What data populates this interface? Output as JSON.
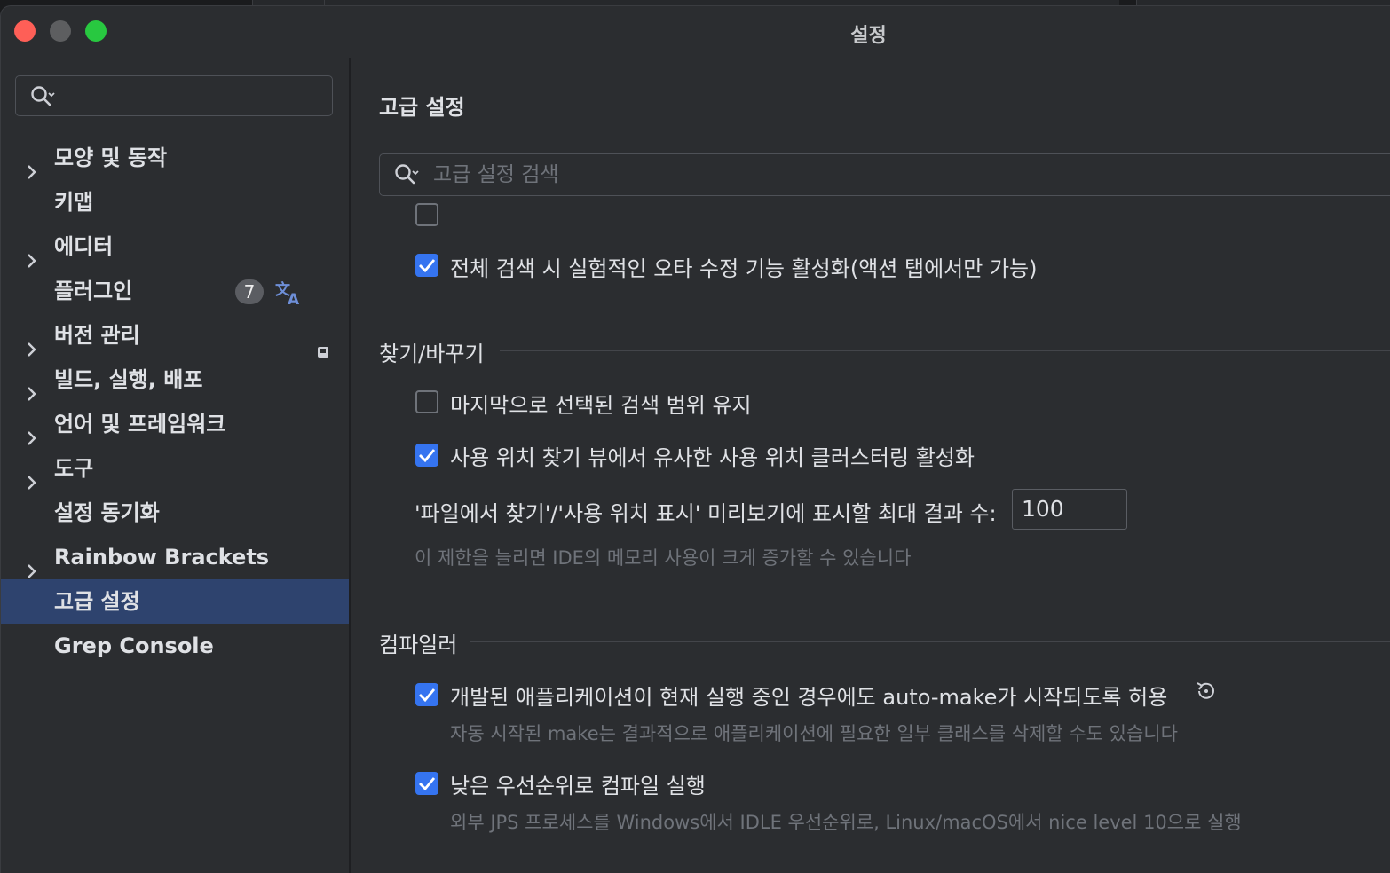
{
  "window": {
    "title": "설정"
  },
  "sidebar": {
    "search": {
      "placeholder": ""
    },
    "items": [
      {
        "label": "모양 및 동작",
        "expandable": true
      },
      {
        "label": "키맵",
        "expandable": false
      },
      {
        "label": "에디터",
        "expandable": true
      },
      {
        "label": "플러그인",
        "expandable": false,
        "badge": "7",
        "icon": "translate-icon"
      },
      {
        "label": "버전 관리",
        "expandable": true,
        "icon": "vcs-project-icon"
      },
      {
        "label": "빌드, 실행, 배포",
        "expandable": true
      },
      {
        "label": "언어 및 프레임워크",
        "expandable": true
      },
      {
        "label": "도구",
        "expandable": true
      },
      {
        "label": "설정 동기화",
        "expandable": false
      },
      {
        "label": "Rainbow Brackets",
        "expandable": true
      },
      {
        "label": "고급 설정",
        "expandable": false,
        "selected": true
      },
      {
        "label": "Grep Console",
        "expandable": false
      }
    ]
  },
  "main": {
    "title": "고급 설정",
    "search": {
      "placeholder": "고급 설정 검색"
    },
    "top_options": [
      {
        "label": "전체 검색 시 실험적인 오타 수정 기능 활성화(액션 탭에서만 가능)",
        "checked": true
      }
    ],
    "sections": [
      {
        "title": "찾기/바꾸기",
        "options": [
          {
            "label": "마지막으로 선택된 검색 범위 유지",
            "checked": false
          },
          {
            "label": "사용 위치 찾기 뷰에서 유사한 사용 위치 클러스터링 활성화",
            "checked": true
          }
        ],
        "field": {
          "label": "'파일에서 찾기'/'사용 위치 표시' 미리보기에 표시할 최대 결과 수:",
          "value": "100",
          "hint": "이 제한을 늘리면 IDE의 메모리 사용이 크게 증가할 수 있습니다"
        }
      },
      {
        "title": "컴파일러",
        "options": [
          {
            "label": "개발된 애플리케이션이 현재 실행 중인 경우에도 auto-make가 시작되도록 허용",
            "checked": true,
            "hint": "자동 시작된 make는 결과적으로 애플리케이션에 필요한 일부 클래스를 삭제할 수도 있습니다",
            "icon": "reset-icon"
          },
          {
            "label": "낮은 우선순위로 컴파일 실행",
            "checked": true,
            "hint": "외부 JPS 프로세스를 Windows에서 IDLE 우선순위로, Linux/macOS에서 nice level 10으로 실행"
          }
        ]
      }
    ]
  },
  "colors": {
    "accent": "#3574f0",
    "selection": "#2e436e",
    "background": "#2b2d30",
    "close": "#fe5f57",
    "zoom": "#28c840"
  }
}
